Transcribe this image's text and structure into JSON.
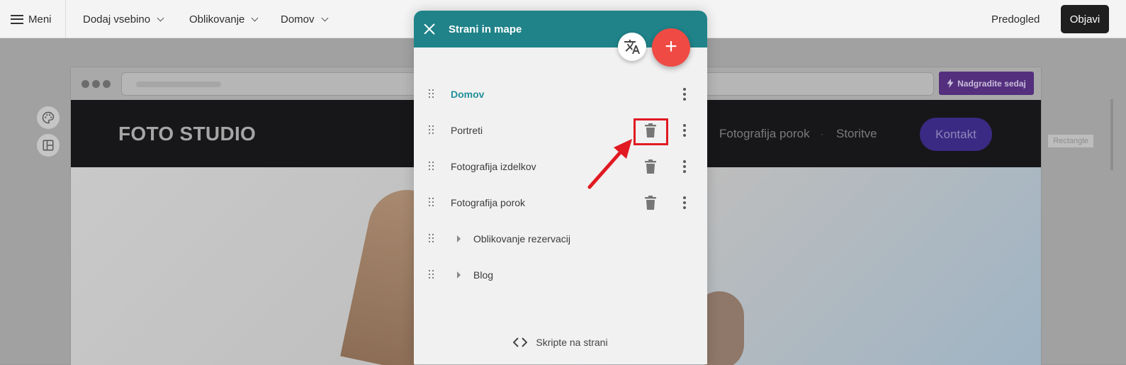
{
  "topbar": {
    "menu_label": "Meni",
    "add_content": "Dodaj vsebino",
    "design": "Oblikovanje",
    "home": "Domov",
    "preview": "Predogled",
    "publish": "Objavi"
  },
  "browser": {
    "upgrade_label": "Nadgradite sedaj"
  },
  "site": {
    "logo": "FOTO STUDIO",
    "nav_items": [
      "Fotografija porok",
      "Storitve"
    ],
    "nav_separator": "·",
    "contact_button": "Kontakt",
    "rectangle_label": "Rectangle"
  },
  "modal": {
    "title": "Strani in mape",
    "pages": [
      {
        "label": "Domov",
        "type": "home"
      },
      {
        "label": "Portreti",
        "type": "page"
      },
      {
        "label": "Fotografija izdelkov",
        "type": "page"
      },
      {
        "label": "Fotografija porok",
        "type": "page"
      },
      {
        "label": "Oblikovanje rezervacij",
        "type": "folder"
      },
      {
        "label": "Blog",
        "type": "folder"
      }
    ],
    "footer_link": "Skripte na strani"
  },
  "colors": {
    "modal_header": "#1f8389",
    "add_fab": "#ef4a43",
    "home_link": "#22909a",
    "highlight": "#e11a22",
    "upgrade_button": "#532f7d",
    "contact_button": "#3b2a83"
  },
  "icons": [
    "menu-icon",
    "chevron-down-icon",
    "close-icon",
    "translate-icon",
    "plus-icon",
    "drag-handle-icon",
    "trash-icon",
    "more-vertical-icon",
    "caret-right-icon",
    "code-icon",
    "lightning-icon",
    "palette-icon",
    "layout-icon"
  ]
}
